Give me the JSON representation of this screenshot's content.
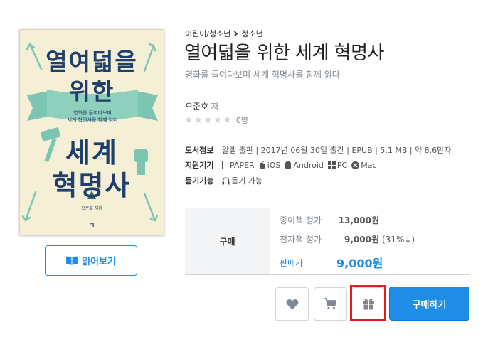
{
  "cover": {
    "title_line1": "열여덟을",
    "title_line2": "위한",
    "title_line3": "세계",
    "title_line4": "혁명사",
    "subtitle_line1": "영화를 들여다보며",
    "subtitle_line2": "세계 혁명사를 함께 읽다",
    "author": "오준호 지음",
    "publisher": "ㄱ"
  },
  "preview_button": {
    "label": "읽어보기",
    "icon": "book-open-icon"
  },
  "breadcrumb": {
    "parent": "어린이/청소년",
    "current": "청소년"
  },
  "book": {
    "title": "열여덟을 위한 세계 혁명사",
    "subtitle": "영화를 들여다보며 세계 혁명사를 함께 읽다",
    "author": "오준호",
    "author_role": "저",
    "rating_count": "0명"
  },
  "info": {
    "book_info_label": "도서정보",
    "book_info_value": "알렙 출판 | 2017년 06월 30일 출간 | EPUB | 5.1 MB | 약 8.6만자",
    "devices_label": "지원기기",
    "devices": [
      "PAPER",
      "iOS",
      "Android",
      "PC",
      "Mac"
    ],
    "tts_label": "듣기기능",
    "tts_value": "듣기 가능"
  },
  "price": {
    "header": "구매",
    "paper_label": "종이책 정가",
    "paper_value": "13,000원",
    "ebook_label": "전자책 정가",
    "ebook_value": "9,000원",
    "ebook_discount": "(31%↓)",
    "sale_label": "판매가",
    "sale_value": "9,000원"
  },
  "actions": {
    "buy_label": "구매하기"
  },
  "colors": {
    "accent": "#1f8ce6",
    "highlight": "#e01d24",
    "cover_title": "#1f3f6c"
  }
}
